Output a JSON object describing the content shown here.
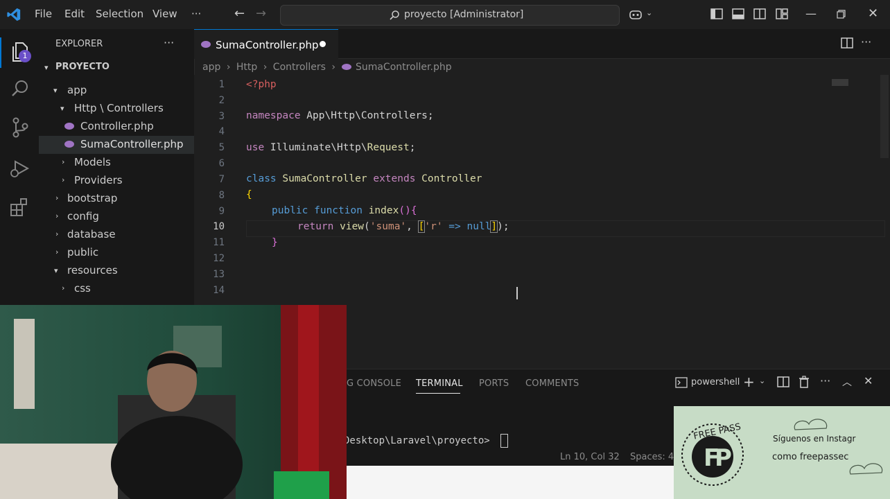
{
  "menu": {
    "items": [
      "File",
      "Edit",
      "Selection",
      "View",
      "···"
    ]
  },
  "command_center": {
    "text": "proyecto [Administrator]"
  },
  "activity_bar": {
    "explorer_badge": "1"
  },
  "sidebar": {
    "title": "EXPLORER",
    "more": "···",
    "root": "PROYECTO",
    "items": [
      {
        "label": "app"
      },
      {
        "label": "Http \\ Controllers"
      },
      {
        "label": "Controller.php"
      },
      {
        "label": "SumaController.php"
      },
      {
        "label": "Models"
      },
      {
        "label": "Providers"
      },
      {
        "label": "bootstrap"
      },
      {
        "label": "config"
      },
      {
        "label": "database"
      },
      {
        "label": "public"
      },
      {
        "label": "resources"
      },
      {
        "label": "css"
      }
    ]
  },
  "editor": {
    "tab_label": "SumaController.php",
    "breadcrumb": [
      "app",
      "Http",
      "Controllers",
      "SumaController.php"
    ],
    "line_numbers": [
      "1",
      "2",
      "3",
      "4",
      "5",
      "6",
      "7",
      "8",
      "9",
      "10",
      "11",
      "12",
      "13",
      "14"
    ],
    "current_line": "10",
    "code": {
      "l1": "<?php",
      "l3_kw": "namespace",
      "l3_rest": " App\\Http\\Controllers;",
      "l5_kw": "use",
      "l5_a": " Illuminate\\Http\\",
      "l5_b": "Request",
      "l5_c": ";",
      "l7_kw": "class",
      "l7_name": " SumaController",
      "l7_ext": " extends",
      "l7_parent": " Controller",
      "l8": "{",
      "l9_kw": "public",
      "l9_fn_kw": " function",
      "l9_name": " index",
      "l9_paren": "(){",
      "l10_kw": "return",
      "l10_fn": " view",
      "l10_a": "(",
      "l10_s1": "'suma'",
      "l10_b": ", ",
      "l10_c": "[",
      "l10_s2": "'r'",
      "l10_d": " => null",
      "l10_e": "]",
      "l10_f": ");",
      "l11": "}"
    }
  },
  "panel": {
    "tabs": [
      "G CONSOLE",
      "TERMINAL",
      "PORTS",
      "COMMENTS"
    ],
    "shell": "powershell",
    "prompt": "Desktop\\Laravel\\proyecto>",
    "status_pos": "Ln 10, Col 32",
    "status_spaces": "Spaces: 4"
  },
  "promo": {
    "line1": "Síguenos en Instagr",
    "line2": "como freepassec",
    "logo_text": "FREE PASS"
  },
  "colors": {
    "accent": "#0078d4",
    "badge": "#6a4fc8",
    "php": "#a074c4"
  }
}
